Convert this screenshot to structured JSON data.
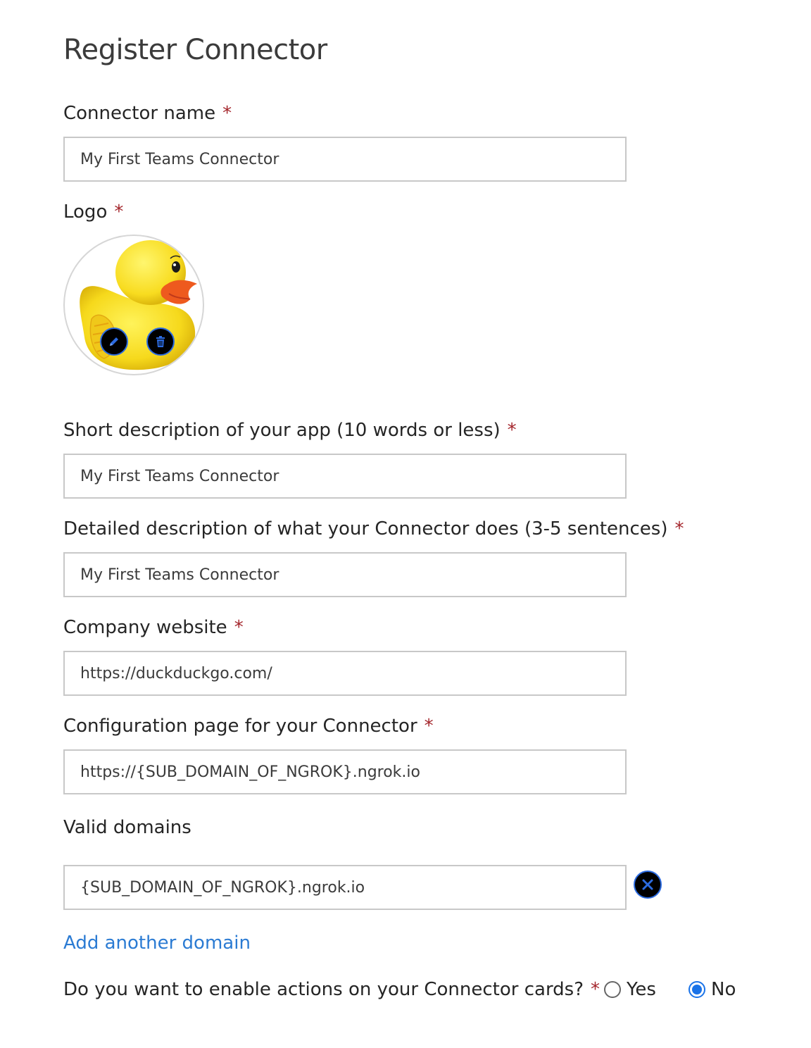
{
  "page": {
    "title": "Register Connector"
  },
  "required_marker": "*",
  "connector_name": {
    "label": "Connector name",
    "value": "My First Teams Connector"
  },
  "logo": {
    "label": "Logo",
    "edit_icon": "pencil-icon",
    "delete_icon": "trash-icon",
    "image": "rubber-duck"
  },
  "short_description": {
    "label": "Short description of your app (10 words or less)",
    "value": "My First Teams Connector"
  },
  "detailed_description": {
    "label": "Detailed description of what your Connector does (3-5 sentences)",
    "value": "My First Teams Connector"
  },
  "company_website": {
    "label": "Company website",
    "value": "https://duckduckgo.com/"
  },
  "configuration_page": {
    "label": "Configuration page for your Connector",
    "value": "https://{SUB_DOMAIN_OF_NGROK}.ngrok.io"
  },
  "valid_domains": {
    "label": "Valid domains",
    "items": [
      "{SUB_DOMAIN_OF_NGROK}.ngrok.io"
    ],
    "remove_icon": "close-icon"
  },
  "add_domain": {
    "label": "Add another domain"
  },
  "actions_question": {
    "label": "Do you want to enable actions on your Connector cards?",
    "options": [
      {
        "label": "Yes",
        "selected": false
      },
      {
        "label": "No",
        "selected": true
      }
    ]
  },
  "colors": {
    "accent": "#1a73e8",
    "link": "#2b7bd3",
    "required": "#a4262c",
    "border": "#c8c8c8"
  }
}
